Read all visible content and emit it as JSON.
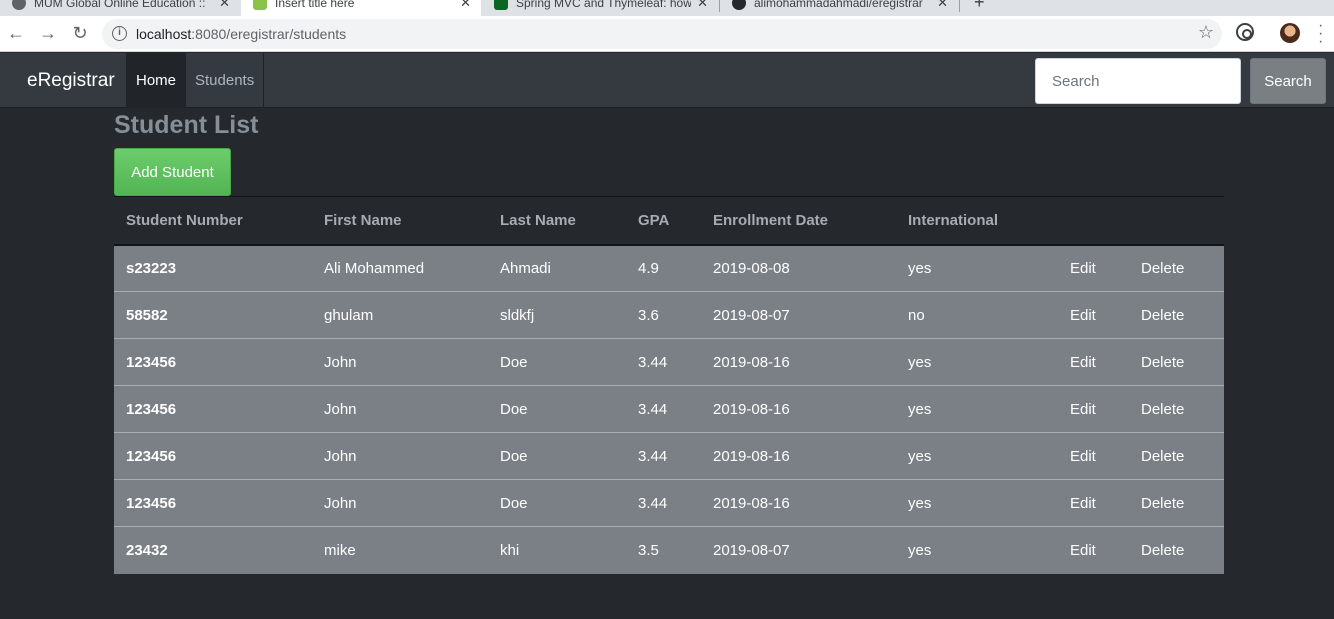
{
  "browser": {
    "tabs": [
      {
        "title": "MUM Global Online Education :: ",
        "active": false,
        "favicon_color": "#5f6368"
      },
      {
        "title": "Insert title here",
        "active": true,
        "favicon_color": "#8bc34a"
      },
      {
        "title": "Spring MVC and Thymeleaf: how",
        "active": false,
        "favicon_color": "#0b6623"
      },
      {
        "title": "alimohammadahmadi/eregistrar",
        "active": false,
        "favicon_color": "#24292e"
      }
    ],
    "url_host": "localhost",
    "url_rest": ":8080/eregistrar/students"
  },
  "navbar": {
    "brand": "eRegistrar",
    "items": [
      {
        "label": "Home",
        "active": true
      },
      {
        "label": "Students",
        "active": false
      }
    ],
    "search_placeholder": "Search",
    "search_button": "Search"
  },
  "main": {
    "title": "Student List",
    "add_button": "Add Student",
    "table": {
      "headers": [
        "Student Number",
        "First Name",
        "Last Name",
        "GPA",
        "Enrollment Date",
        "International"
      ],
      "rows": [
        {
          "student_number": "s23223",
          "first_name": "Ali Mohammed",
          "last_name": "Ahmadi",
          "gpa": "4.9",
          "enrollment_date": "2019-08-08",
          "international": "yes"
        },
        {
          "student_number": "58582",
          "first_name": "ghulam",
          "last_name": "sldkfj",
          "gpa": "3.6",
          "enrollment_date": "2019-08-07",
          "international": "no"
        },
        {
          "student_number": "123456",
          "first_name": "John",
          "last_name": "Doe",
          "gpa": "3.44",
          "enrollment_date": "2019-08-16",
          "international": "yes"
        },
        {
          "student_number": "123456",
          "first_name": "John",
          "last_name": "Doe",
          "gpa": "3.44",
          "enrollment_date": "2019-08-16",
          "international": "yes"
        },
        {
          "student_number": "123456",
          "first_name": "John",
          "last_name": "Doe",
          "gpa": "3.44",
          "enrollment_date": "2019-08-16",
          "international": "yes"
        },
        {
          "student_number": "123456",
          "first_name": "John",
          "last_name": "Doe",
          "gpa": "3.44",
          "enrollment_date": "2019-08-16",
          "international": "yes"
        },
        {
          "student_number": "23432",
          "first_name": "mike",
          "last_name": "khi",
          "gpa": "3.5",
          "enrollment_date": "2019-08-07",
          "international": "yes"
        }
      ],
      "edit_label": "Edit",
      "delete_label": "Delete"
    }
  },
  "colors": {
    "navbar_bg": "#343a40",
    "page_bg": "#25282d",
    "row_bg": "#7b8087",
    "add_button": "#5cb85c"
  }
}
